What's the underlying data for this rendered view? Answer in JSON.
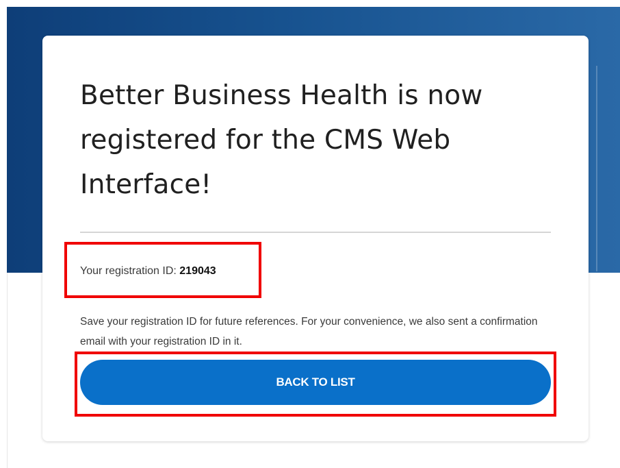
{
  "card": {
    "title": "Better Business Health is now registered for the CMS Web Interface!",
    "registration": {
      "label": "Your registration ID: ",
      "value": "219043"
    },
    "info": "Save your registration ID for future references. For your convenience, we also sent a confirmation email with your registration ID in it.",
    "back_button_label": "BACK TO LIST"
  },
  "colors": {
    "header_band_dark": "#0e3e78",
    "header_band_light": "#2a69a7",
    "primary_button": "#0a70c9",
    "annotation_highlight": "#f00000"
  }
}
